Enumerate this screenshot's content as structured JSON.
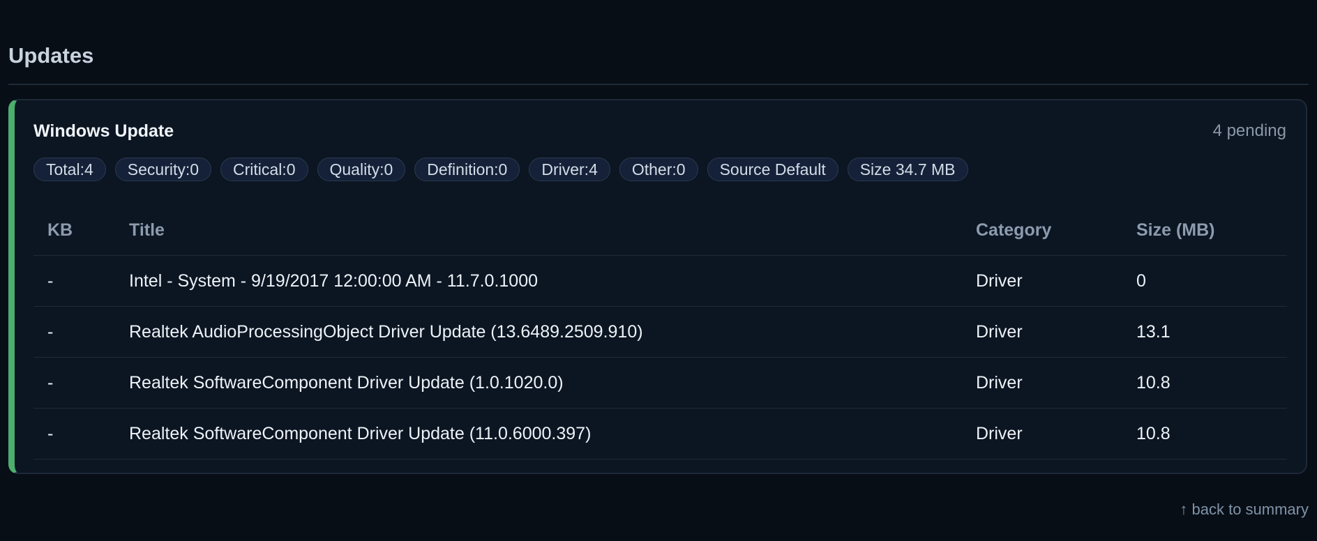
{
  "section": {
    "title": "Updates"
  },
  "card": {
    "title": "Windows Update",
    "status": "4 pending",
    "accent_color": "#4caf6e",
    "chips": [
      "Total:4",
      "Security:0",
      "Critical:0",
      "Quality:0",
      "Definition:0",
      "Driver:4",
      "Other:0",
      "Source Default",
      "Size 34.7 MB"
    ],
    "table": {
      "headers": [
        "KB",
        "Title",
        "Category",
        "Size (MB)"
      ],
      "rows": [
        [
          "-",
          "Intel - System - 9/19/2017 12:00:00 AM - 11.7.0.1000",
          "Driver",
          "0"
        ],
        [
          "-",
          "Realtek AudioProcessingObject Driver Update (13.6489.2509.910)",
          "Driver",
          "13.1"
        ],
        [
          "-",
          "Realtek SoftwareComponent Driver Update (1.0.1020.0)",
          "Driver",
          "10.8"
        ],
        [
          "-",
          "Realtek SoftwareComponent Driver Update (11.0.6000.397)",
          "Driver",
          "10.8"
        ]
      ]
    }
  },
  "footer": {
    "back_link": "↑ back to summary"
  }
}
